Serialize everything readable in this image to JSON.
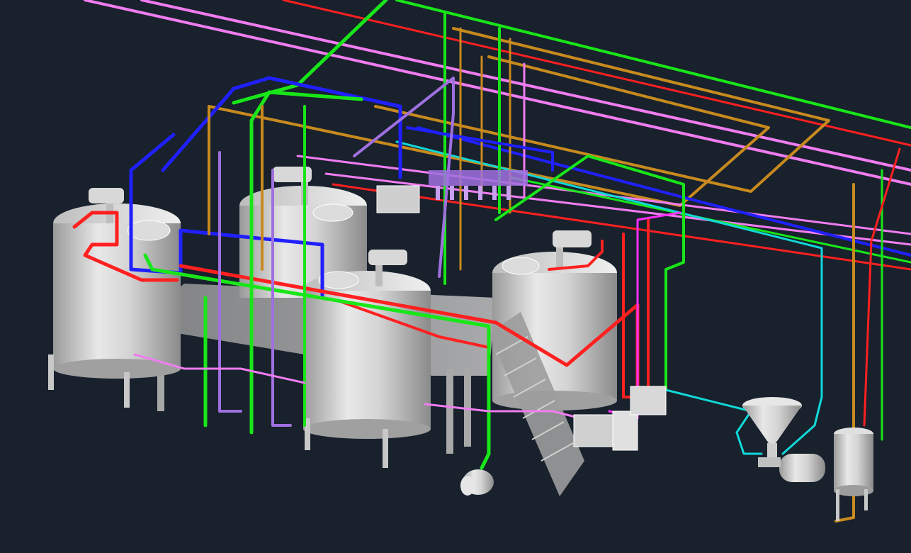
{
  "view": {
    "background": "#18212c",
    "render_style": "3d-shaded-cad-model"
  },
  "pipe_colors": {
    "red": "#ff2020",
    "green": "#19e619",
    "blue": "#2020ff",
    "pink": "#f07cf0",
    "violet": "#a070e0",
    "orange": "#c88a1e",
    "cyan": "#10d8d8",
    "magenta": "#ff30ff"
  },
  "equipment": {
    "tanks": [
      {
        "id": "tank-1",
        "has_agitator": true
      },
      {
        "id": "tank-2",
        "has_agitator": true
      },
      {
        "id": "tank-3",
        "has_agitator": true
      },
      {
        "id": "tank-4",
        "has_agitator": true
      }
    ],
    "platform": {
      "has_stairs": true
    },
    "hopper_pump": {
      "id": "hopper-pump"
    },
    "small_tank": {
      "id": "small-tank"
    },
    "heat_exchanger": {
      "id": "plate-heat-exchanger"
    },
    "motor": {
      "id": "pump-motor"
    }
  }
}
